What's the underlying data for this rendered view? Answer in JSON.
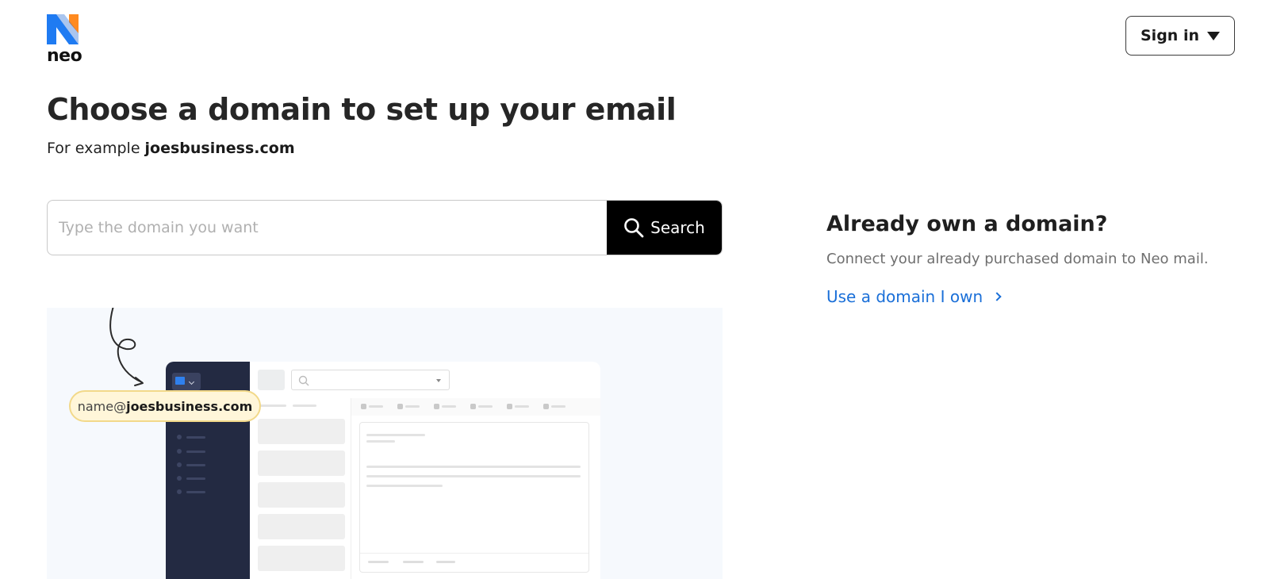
{
  "header": {
    "logo_text": "neo",
    "signin_label": "Sign in"
  },
  "main": {
    "title": "Choose a domain to set up your email",
    "subtitle_prefix": "For example ",
    "subtitle_example": "joesbusiness.com",
    "search_placeholder": "Type the domain you want",
    "search_value": "",
    "search_button_label": "Search"
  },
  "own_domain": {
    "title": "Already own a domain?",
    "description": "Connect your already purchased domain to Neo mail.",
    "link_label": "Use a domain I own"
  },
  "illustration": {
    "email_prefix": "name@",
    "email_domain": "joesbusiness.com"
  },
  "colors": {
    "link": "#1a6fd8",
    "logo_blue": "#1f7bf2",
    "logo_orange": "#ff8a1f",
    "search_button": "#000000",
    "sidebar_dark": "#232a42"
  },
  "icons": {
    "logo": "neo-logo-icon",
    "signin_caret": "caret-down-icon",
    "search": "search-icon",
    "chevron": "chevron-right-icon"
  }
}
